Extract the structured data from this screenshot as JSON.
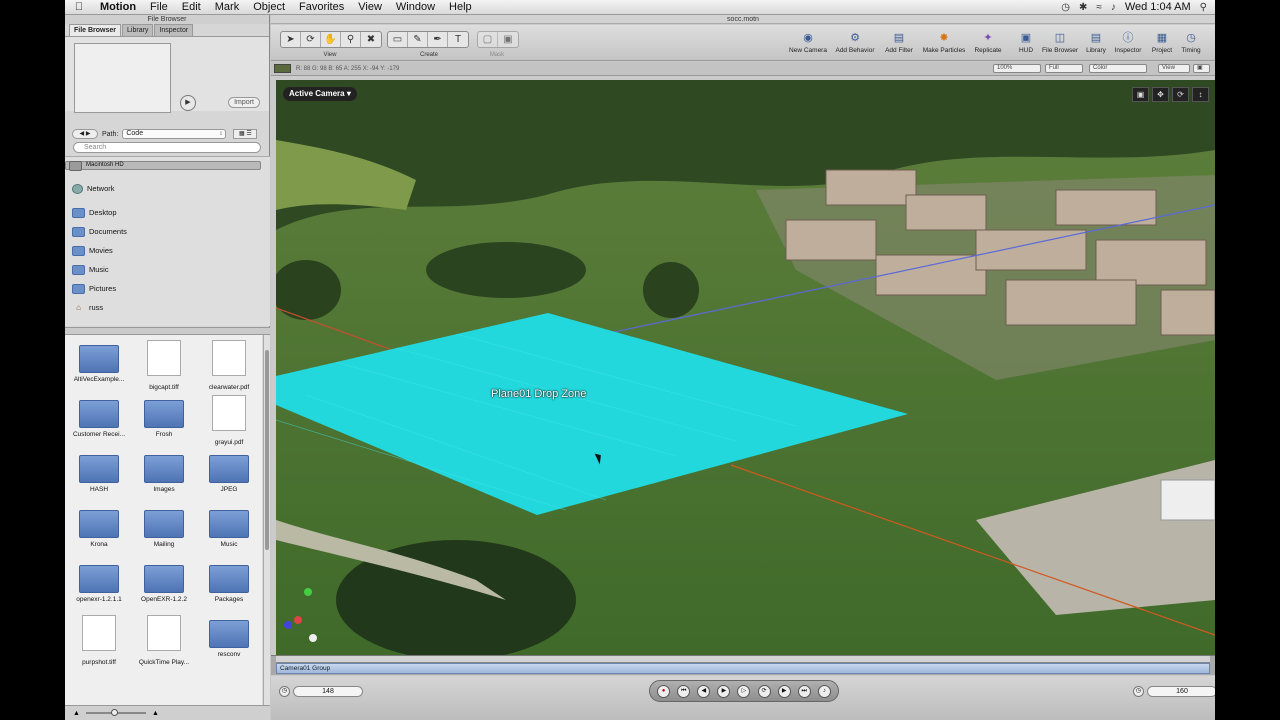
{
  "menubar": {
    "app_name": "Motion",
    "items": [
      "File",
      "Edit",
      "Mark",
      "Object",
      "Favorites",
      "View",
      "Window",
      "Help"
    ],
    "clock": "Wed 1:04 AM"
  },
  "file_browser": {
    "window_title": "File Browser",
    "tabs": [
      "File Browser",
      "Library",
      "Inspector"
    ],
    "import_label": "Import",
    "path_label": "Path:",
    "path_value": "Code",
    "search_placeholder": "Search",
    "sources": [
      "Macintosh HD",
      "Network",
      "Desktop",
      "Documents",
      "Movies",
      "Music",
      "Pictures",
      "russ"
    ],
    "files": [
      {
        "name": "AltiVecExample...",
        "kind": "folder"
      },
      {
        "name": "bigcapt.tiff",
        "kind": "image"
      },
      {
        "name": "clearwater.pdf",
        "kind": "image"
      },
      {
        "name": "Customer Recei...",
        "kind": "folder"
      },
      {
        "name": "Frosh",
        "kind": "folder"
      },
      {
        "name": "grayui.pdf",
        "kind": "image"
      },
      {
        "name": "HASH",
        "kind": "folder"
      },
      {
        "name": "Images",
        "kind": "folder"
      },
      {
        "name": "JPEG",
        "kind": "folder"
      },
      {
        "name": "Krona",
        "kind": "folder"
      },
      {
        "name": "Mailing",
        "kind": "folder"
      },
      {
        "name": "Music",
        "kind": "folder"
      },
      {
        "name": "openexr-1.2.1.1",
        "kind": "folder"
      },
      {
        "name": "OpenEXR-1.2.2",
        "kind": "folder"
      },
      {
        "name": "Packages",
        "kind": "folder"
      },
      {
        "name": "purpshot.tiff",
        "kind": "image"
      },
      {
        "name": "QuickTime Play...",
        "kind": "image"
      },
      {
        "name": "resconv",
        "kind": "folder"
      }
    ]
  },
  "canvas": {
    "window_title": "socc.motn",
    "tool_groups": {
      "view": "View",
      "create": "Create",
      "mask": "Mask"
    },
    "right_tools": [
      "New Camera",
      "Add Behavior",
      "Add Filter",
      "Make Particles",
      "Replicate",
      "HUD",
      "File Browser",
      "Library",
      "Inspector",
      "Project",
      "Timing"
    ],
    "color_info": "R: 88   G: 98   B: 65   A: 255   X: -94   Y: -179",
    "zoom": "100%",
    "resolution": "Full",
    "channel": "Color",
    "view_menu": "View",
    "active_camera": "Active Camera",
    "drop_zone_label": "Plane01 Drop Zone",
    "timeline_group": "Camera01 Group",
    "current_frame": "148",
    "end_frame": "160"
  },
  "colors": {
    "drop_zone": "#22d8dc",
    "field_grass": "#5e8a3a",
    "accent_blue": "#3a5b94"
  }
}
